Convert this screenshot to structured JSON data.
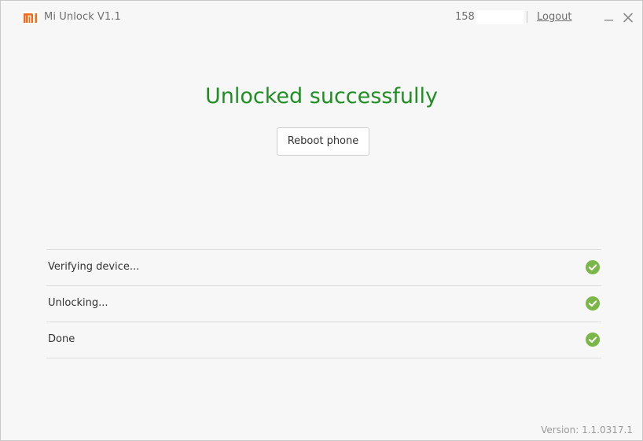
{
  "app": {
    "name": "Mi Unlock",
    "version": "V1.1",
    "logo_icon": "mi-logo-icon",
    "brand_color": "#f26a1b"
  },
  "header": {
    "account": "158",
    "logout_label": "Logout",
    "minimize_icon": "minimize-icon",
    "close_icon": "close-icon"
  },
  "main": {
    "headline": "Unlocked successfully",
    "headline_color": "#1f8f24",
    "reboot_label": "Reboot phone"
  },
  "steps": [
    {
      "label": "Verifying device...",
      "status_icon": "check-circle-icon",
      "status": "done"
    },
    {
      "label": "Unlocking...",
      "status_icon": "check-circle-icon",
      "status": "done"
    },
    {
      "label": "Done",
      "status_icon": "check-circle-icon",
      "status": "done"
    }
  ],
  "check_color": "#7ab648",
  "footer": {
    "version": "Version: 1.1.0317.1"
  }
}
